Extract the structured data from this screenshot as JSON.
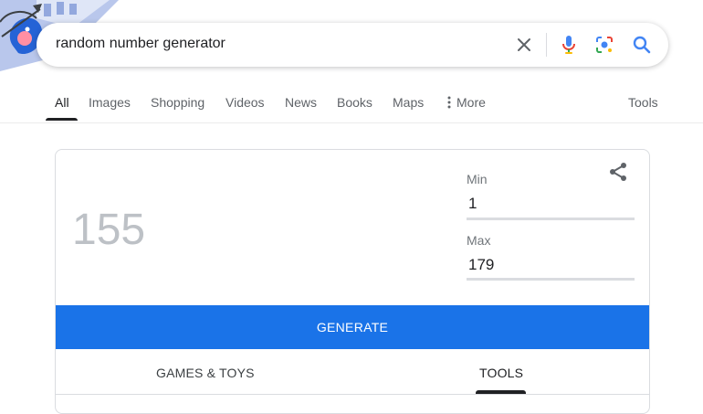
{
  "search": {
    "query": "random number generator"
  },
  "tabs": {
    "items": [
      {
        "label": "All",
        "active": true
      },
      {
        "label": "Images"
      },
      {
        "label": "Shopping"
      },
      {
        "label": "Videos"
      },
      {
        "label": "News"
      },
      {
        "label": "Books"
      },
      {
        "label": "Maps"
      },
      {
        "label": "More"
      }
    ],
    "tools": "Tools"
  },
  "rng": {
    "result": "155",
    "min_label": "Min",
    "min_value": "1",
    "max_label": "Max",
    "max_value": "179",
    "generate_label": "GENERATE",
    "bottom_tabs": [
      "GAMES & TOYS",
      "TOOLS"
    ],
    "bottom_active": "TOOLS"
  },
  "icons": {
    "clear": "close-icon",
    "voice": "mic-icon",
    "lens": "camera-icon",
    "search": "search-icon",
    "more": "more-vert-icon",
    "share": "share-icon"
  },
  "colors": {
    "accent": "#1a73e8",
    "result": "#bdc1c6"
  }
}
